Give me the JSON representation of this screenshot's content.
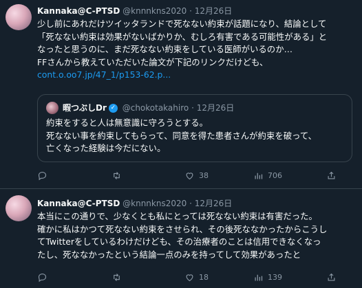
{
  "tweets": [
    {
      "name": "Kannaka@C-PTSD",
      "handle": "@knnnkns2020",
      "separator": "·",
      "date": "12月26日",
      "lines": [
        "少し前にあれだけツイッタランドで死なない約束が話題になり、結論として",
        "「死なない約束は効果がないばかりか、むしろ有害である可能性がある」と",
        "なったと思うのに、まだ死なない約束をしている医師がいるのか…",
        "FFさんから教えていただいた論文が下記のリンクだけども、"
      ],
      "link": "cont.o.oo7.jp/47_1/p153-62.p...",
      "quote": {
        "name": "暇つぶしDr",
        "verified": "✓",
        "handle": "@chokotakahiro",
        "separator": "·",
        "date": "12月26日",
        "lines": [
          "約束をすると人は無意識に守ろうとする。",
          "死なない事を約束してもらって、同意を得た患者さんが約束を破って、",
          "亡くなった経験は今だにない。"
        ]
      },
      "actions": {
        "reply": "",
        "retweet": "",
        "like": "38",
        "views": "706"
      }
    },
    {
      "name": "Kannaka@C-PTSD",
      "handle": "@knnnkns2020",
      "separator": "·",
      "date": "12月26日",
      "lines": [
        "本当にこの通りで、少なくとも私にとっては死なない約束は有害だった。",
        "確かに私はかつて死なない約束をさせられ、その後死ななかったからこうし",
        "てTwitterをしているわけだけども、その治療者のことは信用できなくなっ",
        "たし、死ななかったという結論一点のみを持ってして効果があったと"
      ],
      "actions": {
        "reply": "",
        "retweet": "",
        "like": "18",
        "views": "139"
      }
    }
  ],
  "colors": {
    "background": "#15202b",
    "text": "#f7f9f9",
    "muted": "#8b98a5",
    "link": "#1d9bf0",
    "border": "#38444d"
  }
}
